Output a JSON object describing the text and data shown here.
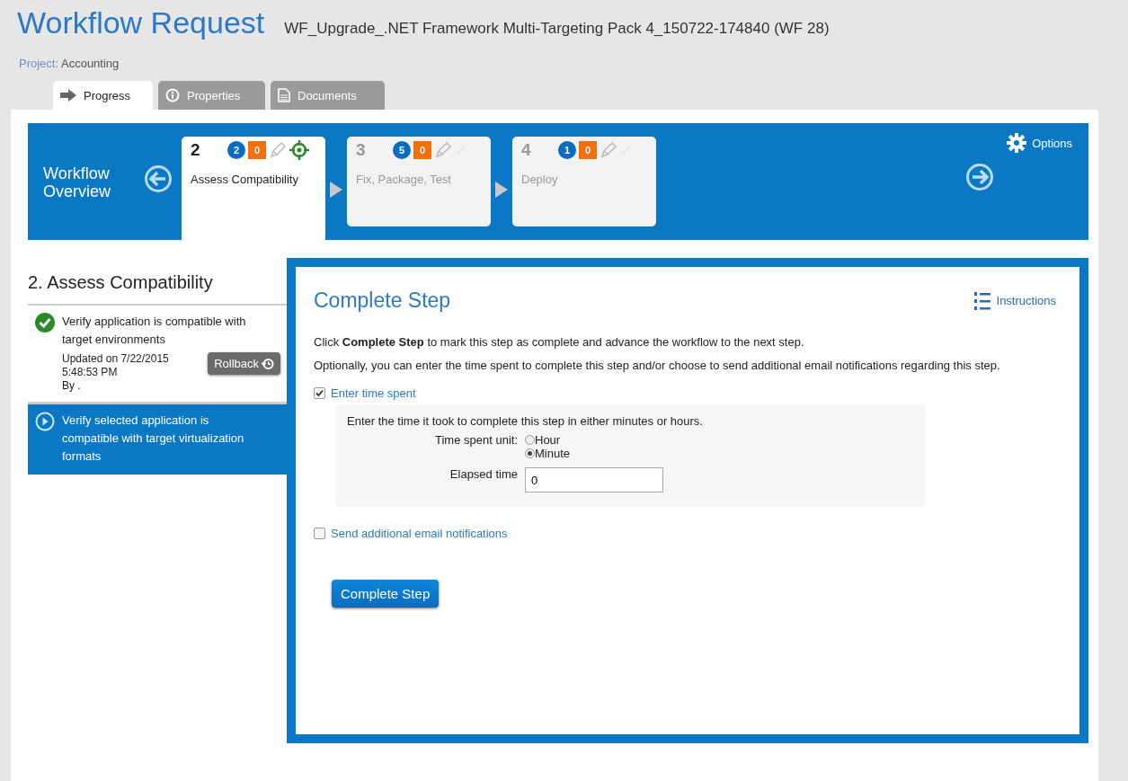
{
  "header": {
    "title": "Workflow Request",
    "subtitle": "WF_Upgrade_.NET Framework Multi-Targeting Pack 4_150722-174840 (WF 28)",
    "project_label": "Project:",
    "project_value": "Accounting"
  },
  "tabs": [
    {
      "label": "Progress",
      "kind": "arrow",
      "selected": true
    },
    {
      "label": "Properties",
      "kind": "info",
      "selected": false
    },
    {
      "label": "Documents",
      "kind": "document",
      "selected": false
    }
  ],
  "overview": {
    "title": "Workflow Overview",
    "options": "Options",
    "steps": [
      {
        "number": "2",
        "name": "Assess Compatibility",
        "count_blue": "2",
        "count_orange": "0",
        "selected": true
      },
      {
        "number": "3",
        "name": "Fix, Package, Test",
        "count_blue": "5",
        "count_orange": "0",
        "selected": false
      },
      {
        "number": "4",
        "name": "Deploy",
        "count_blue": "1",
        "count_orange": "0",
        "selected": false
      }
    ]
  },
  "task_panel": {
    "heading": "2. Assess Compatibility",
    "tasks": [
      {
        "text": "Verify application is compatible with target environments",
        "completed": true,
        "selected": false,
        "updated": "Updated on 7/22/2015 5:48:53 PM",
        "by": "By .",
        "rollback": "Rollback"
      },
      {
        "text": "Verify selected application is compatible with target virtualization formats",
        "completed": false,
        "selected": true
      }
    ]
  },
  "complete_step": {
    "title": "Complete Step",
    "instructions": "Instructions",
    "paragraphs": [
      "Click **Complete Step** to mark this step as complete and advance the workflow to the next step.",
      "Optionally, you can enter the time spent to complete this step and/or choose to send additional email notifications regarding this step."
    ],
    "time_spent": {
      "label": "Enter time spent",
      "checked": true
    },
    "time_box": {
      "hint": "Enter the time it took to complete this step in either minutes or hours.",
      "unit_label": "Time spent unit:",
      "units": [
        {
          "label": "Hour",
          "selected": false
        },
        {
          "label": "Minute",
          "selected": true
        }
      ],
      "elapsed_label": "Elapsed time",
      "elapsed_value": "0"
    },
    "email": {
      "label": "Send additional email notifications",
      "checked": false
    },
    "button": "Complete Step"
  }
}
